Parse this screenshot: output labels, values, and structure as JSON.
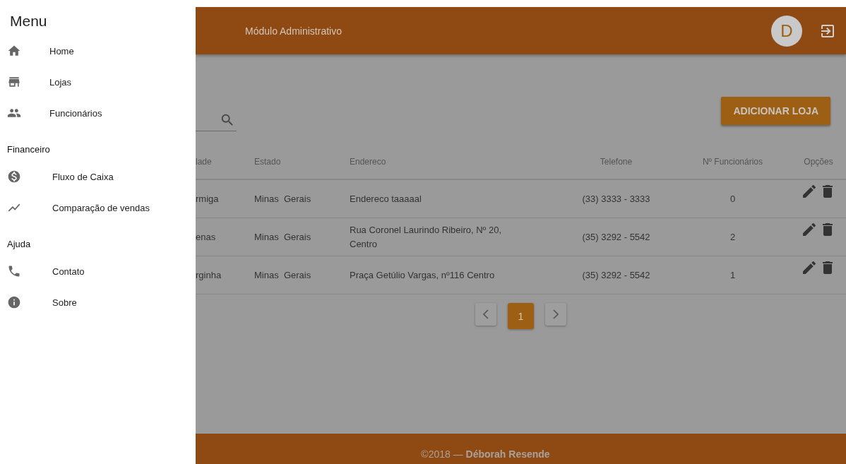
{
  "drawer": {
    "title": "Menu",
    "items": [
      {
        "kind": "home",
        "label": "Home"
      },
      {
        "kind": "store",
        "label": "Lojas"
      },
      {
        "kind": "people",
        "label": "Funcionários"
      }
    ],
    "sections": [
      {
        "heading": "Financeiro",
        "items": [
          {
            "kind": "dollar",
            "label": "Fluxo de Caixa"
          },
          {
            "kind": "chart",
            "label": "Comparação de vendas"
          }
        ]
      },
      {
        "heading": "Ajuda",
        "items": [
          {
            "kind": "phone",
            "label": "Contato"
          },
          {
            "kind": "info",
            "label": "Sobre"
          }
        ]
      }
    ]
  },
  "header": {
    "title": "Módulo Administrativo",
    "avatar": "D"
  },
  "toolbar": {
    "add_button": "ADICIONAR LOJA"
  },
  "table": {
    "columns": [
      "lade",
      "Estado",
      "Endereco",
      "Telefone",
      "Nº Funcionários",
      "Opções"
    ],
    "rows": [
      {
        "cells": [
          "rmiga",
          "Minas  Gerais",
          "Endereco taaaaal",
          "(33) 3333 - 3333",
          "0"
        ]
      },
      {
        "cells": [
          "enas",
          "Minas  Gerais",
          "Rua Coronel Laurindo Ribeiro, Nº 20, Centro",
          "(35) 3292 - 5542",
          "2"
        ]
      },
      {
        "cells": [
          "rginha",
          "Minas  Gerais",
          "Praça Getúlio Vargas, nº116 Centro",
          "(35) 3292 - 5542",
          "1"
        ]
      }
    ]
  },
  "pagination": {
    "pages": [
      {
        "label": "1",
        "selected": true
      }
    ]
  },
  "footer": {
    "text": "©2018 — **Déborah Resende**"
  }
}
